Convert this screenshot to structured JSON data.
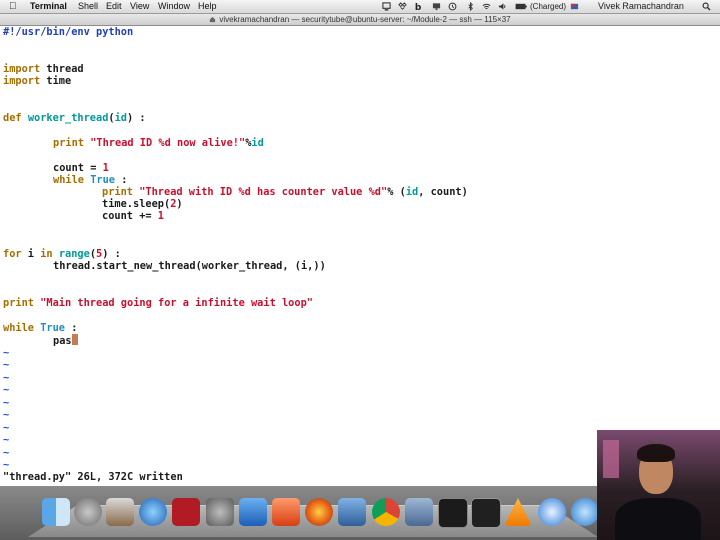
{
  "menubar": {
    "app": "Terminal",
    "items": [
      "Shell",
      "Edit",
      "View",
      "Window",
      "Help"
    ],
    "battery": "(Charged)",
    "user": "Vivek Ramachandran"
  },
  "window": {
    "title": "vivekramachandran — securitytube@ubuntu-server: ~/Module-2 — ssh — 115×37"
  },
  "code": {
    "l1": "#!/usr/bin/env python",
    "l4a": "import",
    "l4b": " thread",
    "l5a": "import",
    "l5b": " time",
    "l8a": "def",
    "l8b": " ",
    "l8c": "worker_thread",
    "l8d": "(",
    "l8e": "id",
    "l8f": ") :",
    "l10a": "print",
    "l10b": " ",
    "l10c": "\"Thread ID %d now alive!\"",
    "l10d": "%",
    "l10e": "id",
    "l12a": "count = ",
    "l12b": "1",
    "l13a": "while",
    "l13b": " ",
    "l13c": "True",
    "l13d": " :",
    "l14a": "print",
    "l14b": " ",
    "l14c": "\"Thread with ID %d has counter value %d\"",
    "l14d": "% (",
    "l14e": "id",
    "l14f": ", count)",
    "l15a": "time.sleep(",
    "l15b": "2",
    "l15c": ")",
    "l16a": "count += ",
    "l16b": "1",
    "l19a": "for",
    "l19b": " i ",
    "l19c": "in",
    "l19d": " ",
    "l19e": "range",
    "l19f": "(",
    "l19g": "5",
    "l19h": ") :",
    "l20": "thread.start_new_thread(worker_thread, (i,))",
    "l23a": "print",
    "l23b": " ",
    "l23c": "\"Main thread going for a infinite wait loop\"",
    "l25a": "while",
    "l25b": " ",
    "l25c": "True",
    "l25d": " :",
    "l26": "pas",
    "tilde": "~"
  },
  "vim_status": "\"thread.py\" 26L, 372C written",
  "dock": [
    "finder-icon",
    "launchpad-icon",
    "preview-icon",
    "itunes-icon",
    "photobooth-icon",
    "system-preferences-icon",
    "word-icon",
    "powerpoint-icon",
    "firefox-icon",
    "virtualbox-icon",
    "chrome-icon",
    "utility-icon",
    "terminal-icon",
    "display-icon",
    "vlc-icon",
    "safari-icon",
    "app-icon"
  ]
}
